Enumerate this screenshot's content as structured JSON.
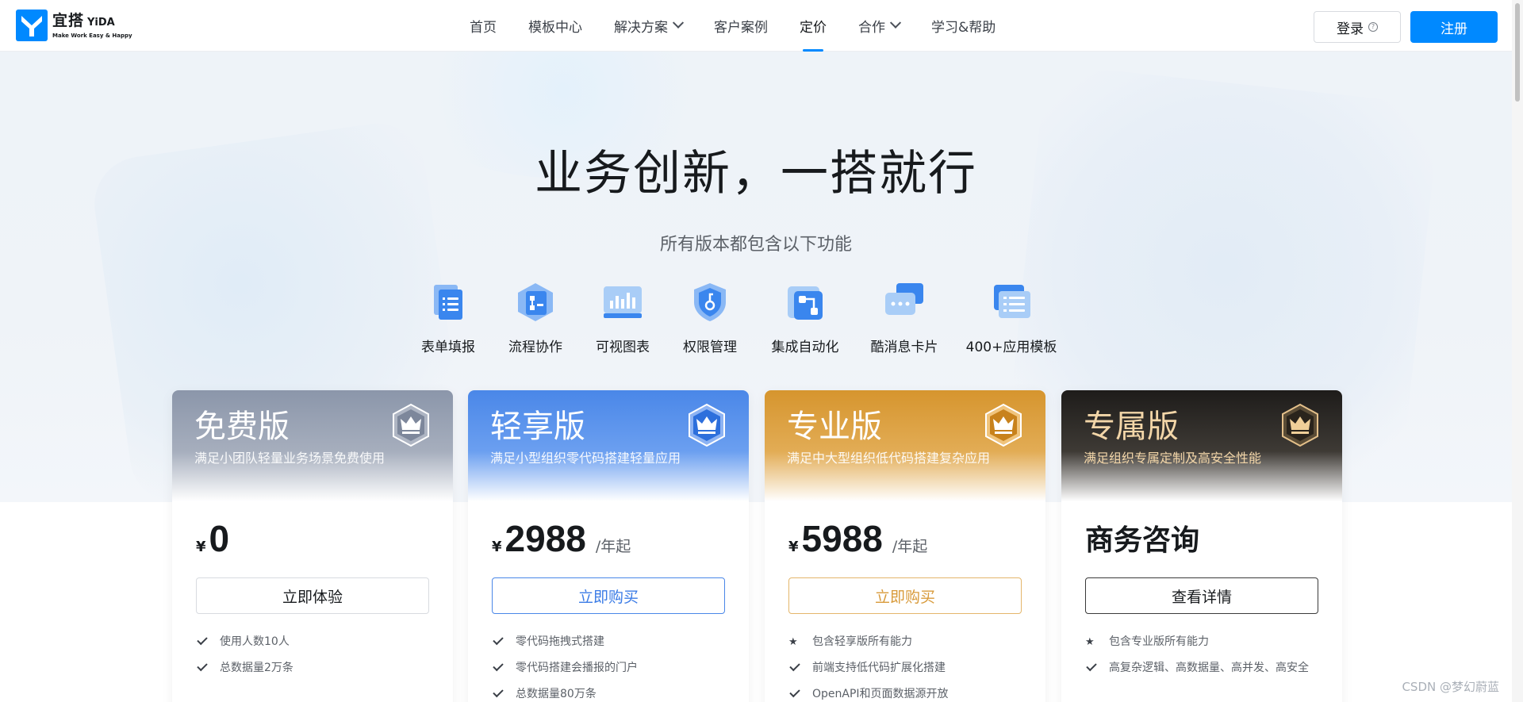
{
  "header": {
    "logo": {
      "cn": "宜搭",
      "en": "YiDA",
      "slogan": "Make Work Easy & Happy"
    },
    "nav": [
      {
        "label": "首页",
        "dropdown": false,
        "active": false
      },
      {
        "label": "模板中心",
        "dropdown": false,
        "active": false
      },
      {
        "label": "解决方案",
        "dropdown": true,
        "active": false
      },
      {
        "label": "客户案例",
        "dropdown": false,
        "active": false
      },
      {
        "label": "定价",
        "dropdown": false,
        "active": true
      },
      {
        "label": "合作",
        "dropdown": true,
        "active": false
      },
      {
        "label": "学习&帮助",
        "dropdown": false,
        "active": false
      }
    ],
    "login_label": "登录",
    "register_label": "注册"
  },
  "hero": {
    "title": "业务创新，一搭就行",
    "subtitle": "所有版本都包含以下功能",
    "features": [
      {
        "label": "表单填报",
        "icon": "form-icon"
      },
      {
        "label": "流程协作",
        "icon": "workflow-icon"
      },
      {
        "label": "可视图表",
        "icon": "chart-icon"
      },
      {
        "label": "权限管理",
        "icon": "permission-icon"
      },
      {
        "label": "集成自动化",
        "icon": "integration-icon"
      },
      {
        "label": "酷消息卡片",
        "icon": "message-card-icon"
      },
      {
        "label": "400+应用模板",
        "icon": "template-icon"
      }
    ]
  },
  "plans": [
    {
      "name": "免费版",
      "desc": "满足小团队轻量业务场景免费使用",
      "currency": "¥",
      "price": "0",
      "unit": "",
      "button": "立即体验",
      "features": [
        {
          "mark": "check",
          "text": "使用人数10人"
        },
        {
          "mark": "check",
          "text": "总数据量2万条"
        }
      ]
    },
    {
      "name": "轻享版",
      "desc": "满足小型组织零代码搭建轻量应用",
      "currency": "¥",
      "price": "2988",
      "unit": "/年起",
      "button": "立即购买",
      "features": [
        {
          "mark": "check",
          "text": "零代码拖拽式搭建"
        },
        {
          "mark": "check",
          "text": "零代码搭建会播报的门户"
        },
        {
          "mark": "check",
          "text": "总数据量80万条"
        }
      ]
    },
    {
      "name": "专业版",
      "desc": "满足中大型组织低代码搭建复杂应用",
      "currency": "¥",
      "price": "5988",
      "unit": "/年起",
      "button": "立即购买",
      "features": [
        {
          "mark": "star",
          "text": "包含轻享版所有能力"
        },
        {
          "mark": "check",
          "text": "前端支持低代码扩展化搭建"
        },
        {
          "mark": "check",
          "text": "OpenAPI和页面数据源开放"
        }
      ]
    },
    {
      "name": "专属版",
      "desc": "满足组织专属定制及高安全性能",
      "consult": "商务咨询",
      "button": "查看详情",
      "features": [
        {
          "mark": "star",
          "text": "包含专业版所有能力"
        },
        {
          "mark": "check",
          "text": "高复杂逻辑、高数据量、高并发、高安全"
        }
      ]
    }
  ],
  "watermark": "CSDN @梦幻蔚蓝",
  "colors": {
    "brand": "#0089ff",
    "free": "#8b96aa",
    "lite": "#4a87e8",
    "pro": "#d6952e",
    "exclusive": "#1e1c1a"
  }
}
